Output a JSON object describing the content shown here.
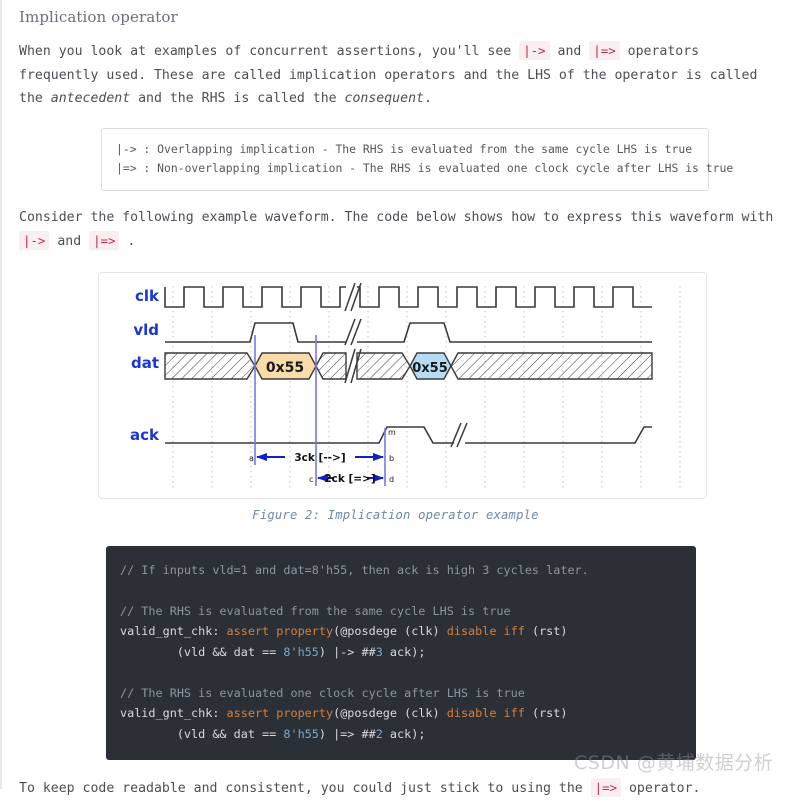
{
  "section": {
    "title": "Implication operator"
  },
  "paragraph1": {
    "part1": "When you look at examples of concurrent assertions, you'll see ",
    "code1": "|->",
    "part2": " and ",
    "code2": "|=>",
    "part3": " operators frequently used. These are called implication operators and the LHS of the operator is called the ",
    "em1": "antecedent",
    "part4": " and the RHS is called the ",
    "em2": "consequent",
    "part5": "."
  },
  "note_box": {
    "line1": "|-> : Overlapping implication - The RHS is evaluated from the same cycle LHS is true",
    "line2": "|=> : Non-overlapping implication - The RHS is evaluated one clock cycle after LHS is true"
  },
  "paragraph2": {
    "part1": "Consider the following example waveform. The code below shows how to express this waveform with ",
    "code1": "|->",
    "part2": " and ",
    "code2": "|=>",
    "part3": " ."
  },
  "figure": {
    "caption": "Figure 2: Implication operator example",
    "signals": [
      {
        "name": "clk",
        "label": "clk"
      },
      {
        "name": "vld",
        "label": "vld"
      },
      {
        "name": "dat",
        "label": "dat"
      },
      {
        "name": "ack",
        "label": "ack"
      }
    ],
    "data_values": [
      {
        "text": "0x55",
        "fill": "#fadcab"
      },
      {
        "text": "0x55",
        "fill": "#b6dcf5"
      }
    ],
    "markers": [
      "a",
      "b",
      "c",
      "d",
      "m"
    ],
    "annotations": [
      {
        "text": "3ck [-->]"
      },
      {
        "text": "2ck [=>]"
      }
    ],
    "colors": {
      "label": "#1a35d8",
      "marker_line": "#7a7ae0",
      "arrow": "#1020cc",
      "wave": "#3a3a3a",
      "grid": "#bdbdbd"
    }
  },
  "code_block": {
    "lines": [
      [
        {
          "t": "// If inputs vld=1 and dat=8'h55, then ack is high 3 cycles later.",
          "c": "tok-comment"
        }
      ],
      [
        {
          "t": "",
          "c": "tok-plain"
        }
      ],
      [
        {
          "t": "// The RHS is evaluated from the same cycle LHS is true",
          "c": "tok-comment"
        }
      ],
      [
        {
          "t": "valid_gnt_chk: ",
          "c": "tok-plain"
        },
        {
          "t": "assert property",
          "c": "tok-kw"
        },
        {
          "t": "(@posdege (clk) ",
          "c": "tok-plain"
        },
        {
          "t": "disable iff",
          "c": "tok-kw"
        },
        {
          "t": " (rst)",
          "c": "tok-plain"
        }
      ],
      [
        {
          "t": "        (vld && dat == ",
          "c": "tok-plain"
        },
        {
          "t": "8'h55",
          "c": "tok-num"
        },
        {
          "t": ") |-> ##",
          "c": "tok-plain"
        },
        {
          "t": "3",
          "c": "tok-num"
        },
        {
          "t": " ack);",
          "c": "tok-plain"
        }
      ],
      [
        {
          "t": "",
          "c": "tok-plain"
        }
      ],
      [
        {
          "t": "// The RHS is evaluated one clock cycle after LHS is true",
          "c": "tok-comment"
        }
      ],
      [
        {
          "t": "valid_gnt_chk: ",
          "c": "tok-plain"
        },
        {
          "t": "assert property",
          "c": "tok-kw"
        },
        {
          "t": "(@posdege (clk) ",
          "c": "tok-plain"
        },
        {
          "t": "disable iff",
          "c": "tok-kw"
        },
        {
          "t": " (rst)",
          "c": "tok-plain"
        }
      ],
      [
        {
          "t": "        (vld && dat == ",
          "c": "tok-plain"
        },
        {
          "t": "8'h55",
          "c": "tok-num"
        },
        {
          "t": ") |=> ##",
          "c": "tok-plain"
        },
        {
          "t": "2",
          "c": "tok-num"
        },
        {
          "t": " ack);",
          "c": "tok-plain"
        }
      ]
    ]
  },
  "paragraph3": {
    "part1": "To keep code readable and consistent, you could just stick to using the ",
    "code1": "|=>",
    "part2": " operator."
  },
  "watermark": {
    "text": "CSDN @黄埔数据分析"
  }
}
